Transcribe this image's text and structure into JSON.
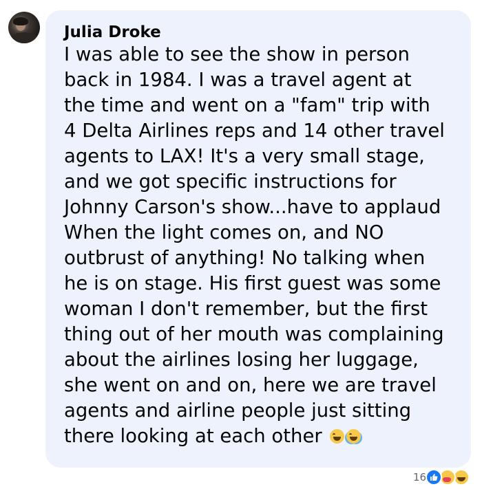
{
  "comment": {
    "author": "Julia Droke",
    "lines": [
      "I was able to see the show in person",
      "back in 1984. I was a travel agent at",
      "the time and went on a \"fam\" trip with",
      "4 Delta Airlines reps and 14 other travel",
      "agents to LAX! It's a very small stage,",
      "and we got specific instructions for",
      "Johnny Carson's show...have to applaud",
      "When the light comes on, and NO",
      "outbrust of anything! No talking when",
      "he is on stage. His first guest was some",
      "woman I don't remember, but the first",
      "thing out of her mouth was complaining",
      "about the airlines losing her luggage,",
      "she went on and on, here we are travel",
      "agents and airline people just sitting",
      "there looking at each other"
    ],
    "inline_emojis": [
      "laughing-squint-emoji",
      "tears-of-joy-emoji"
    ]
  },
  "reactions": {
    "count": "16",
    "types": [
      "like",
      "care",
      "haha"
    ]
  },
  "colors": {
    "bubble_bg": "#edf2fc",
    "text": "#050505",
    "meta_text": "#65676b",
    "like_blue": "#1877f2"
  }
}
